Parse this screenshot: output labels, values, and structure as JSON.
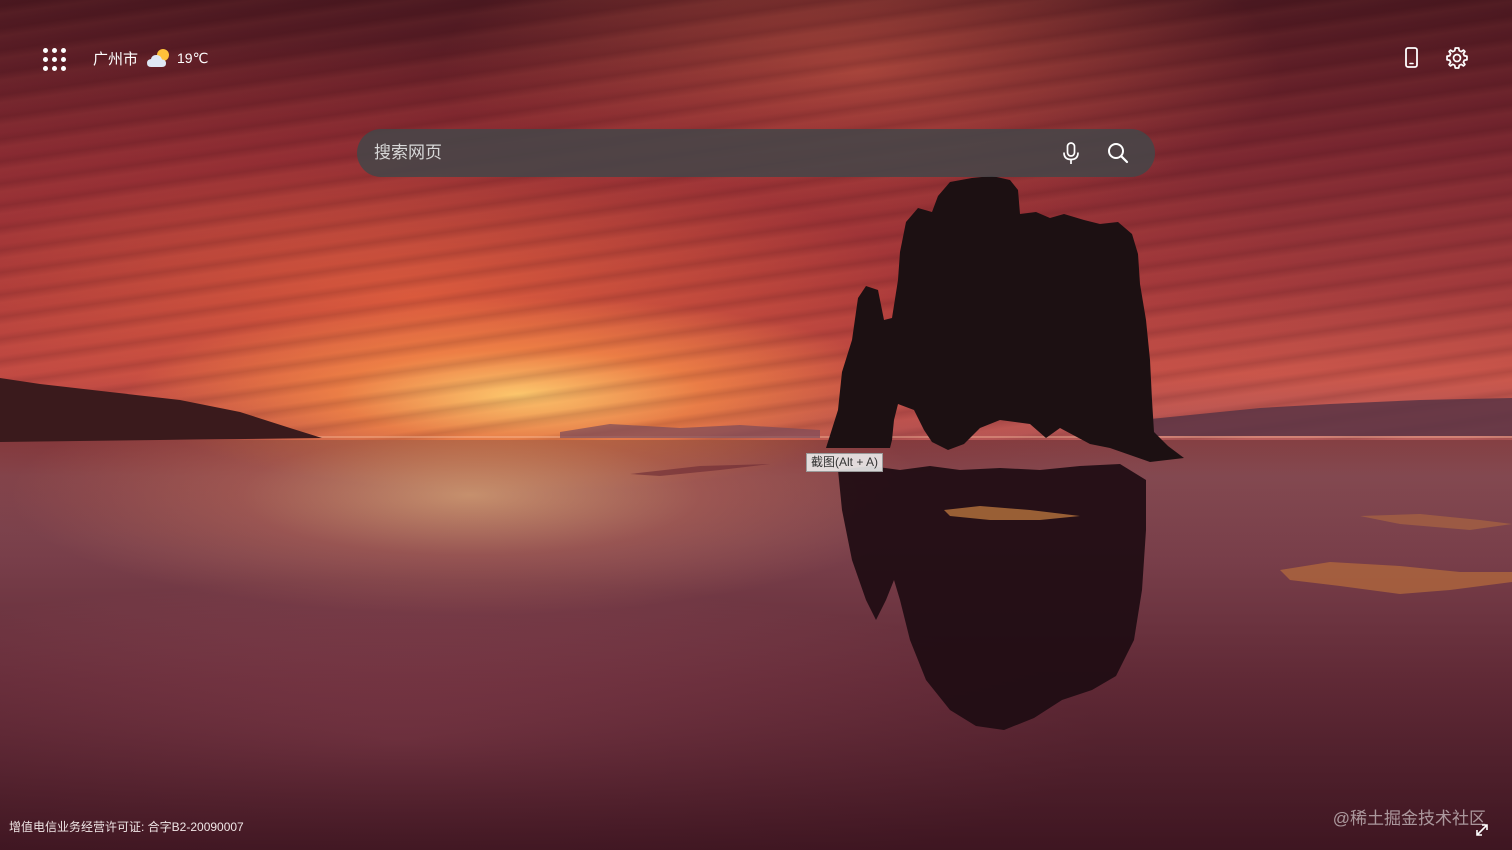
{
  "topbar": {
    "city": "广州市",
    "temperature": "19℃",
    "weather_icon": "partly-cloudy-icon",
    "apps_icon": "apps-grid-icon",
    "phone_icon": "mobile-phone-icon",
    "settings_icon": "gear-icon"
  },
  "search": {
    "placeholder": "搜索网页",
    "mic_icon": "microphone-icon",
    "search_icon": "search-icon"
  },
  "tooltip": {
    "text": "截图(Alt + A)"
  },
  "footer": {
    "license": "增值电信业务经营许可证: 合字B2-20090007",
    "watermark": "@稀土掘金技术社区",
    "expand_icon": "expand-icon"
  },
  "colors": {
    "search_bar_bg": "#464648",
    "text": "#ffffff"
  }
}
